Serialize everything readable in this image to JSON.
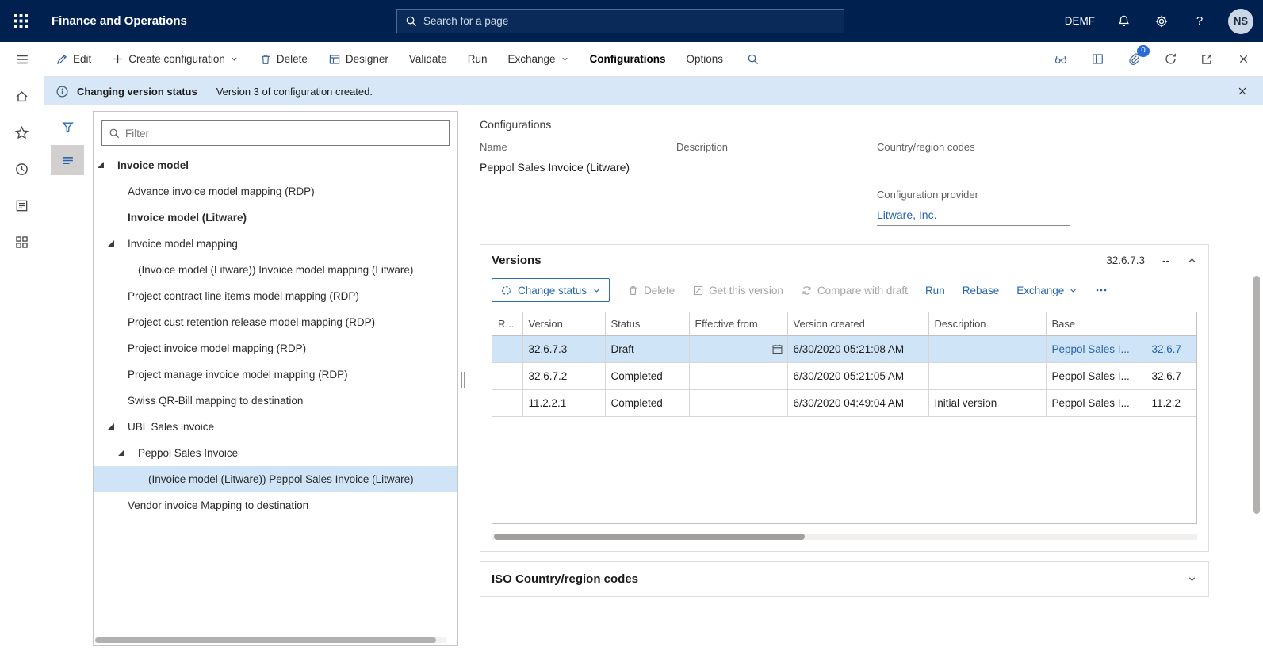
{
  "colors": {
    "topbar_bg": "#002050",
    "accent_blue": "#2565ae",
    "selection_bg": "#cfe4f6",
    "message_bar_bg": "#d7e7f7",
    "disabled_text": "#a6a4a2"
  },
  "topbar": {
    "title": "Finance and Operations",
    "search_placeholder": "Search for a page",
    "company": "DEMF",
    "help": "?",
    "avatar_initials": "NS"
  },
  "action_pane": {
    "edit": "Edit",
    "create_configuration": "Create configuration",
    "delete": "Delete",
    "designer": "Designer",
    "validate": "Validate",
    "run": "Run",
    "exchange": "Exchange",
    "tab_configurations": "Configurations",
    "tab_options": "Options",
    "attachments_badge": "0"
  },
  "message_bar": {
    "title": "Changing version status",
    "message": "Version 3 of configuration created."
  },
  "left_panel": {
    "filter_placeholder": "Filter"
  },
  "tree_panel": {
    "items": [
      {
        "label": "Invoice model",
        "level": 0,
        "bold": true,
        "caret": true
      },
      {
        "label": "Advance invoice model mapping (RDP)",
        "level": 1
      },
      {
        "label": "Invoice model (Litware)",
        "level": 1,
        "bold": true
      },
      {
        "label": "Invoice model mapping",
        "level": 1,
        "caret": true
      },
      {
        "label": "(Invoice model (Litware)) Invoice model mapping (Litware)",
        "level": 2
      },
      {
        "label": "Project contract line items model mapping (RDP)",
        "level": 1
      },
      {
        "label": "Project cust retention release model mapping (RDP)",
        "level": 1
      },
      {
        "label": "Project invoice model mapping (RDP)",
        "level": 1
      },
      {
        "label": "Project manage invoice model mapping (RDP)",
        "level": 1
      },
      {
        "label": "Swiss QR-Bill mapping to destination",
        "level": 1
      },
      {
        "label": "UBL Sales invoice",
        "level": 1,
        "caret": true
      },
      {
        "label": "Peppol Sales Invoice",
        "level": 2,
        "caret": true
      },
      {
        "label": "(Invoice model (Litware)) Peppol Sales Invoice (Litware)",
        "level": 3,
        "selected": true
      },
      {
        "label": "Vendor invoice Mapping to destination",
        "level": 1
      }
    ]
  },
  "details": {
    "heading": "Configurations",
    "name_label": "Name",
    "name_value": "Peppol Sales Invoice (Litware)",
    "description_label": "Description",
    "description_value": "",
    "country_label": "Country/region codes",
    "country_value": "",
    "provider_label": "Configuration provider",
    "provider_value": "Litware, Inc."
  },
  "versions": {
    "title": "Versions",
    "summary_version": "32.6.7.3",
    "summary_extra": "--",
    "toolbar": {
      "change_status": "Change status",
      "delete": "Delete",
      "get_this_version": "Get this version",
      "compare_with_draft": "Compare with draft",
      "run": "Run",
      "rebase": "Rebase",
      "exchange": "Exchange"
    },
    "grid": {
      "columns": [
        "R...",
        "Version",
        "Status",
        "Effective from",
        "Version created",
        "Description",
        "Base",
        ""
      ],
      "rows": [
        {
          "version": "32.6.7.3",
          "status": "Draft",
          "effective_from": "",
          "version_created": "6/30/2020 05:21:08 AM",
          "description": "",
          "base_name": "Peppol Sales I...",
          "base_version": "32.6.7",
          "selected": true,
          "calendar": true
        },
        {
          "version": "32.6.7.2",
          "status": "Completed",
          "effective_from": "",
          "version_created": "6/30/2020 05:21:05 AM",
          "description": "",
          "base_name": "Peppol Sales I...",
          "base_version": "32.6.7"
        },
        {
          "version": "11.2.2.1",
          "status": "Completed",
          "effective_from": "",
          "version_created": "6/30/2020 04:49:04 AM",
          "description": "Initial version",
          "base_name": "Peppol Sales I...",
          "base_version": "11.2.2"
        }
      ]
    }
  },
  "iso_section": {
    "title": "ISO Country/region codes"
  }
}
